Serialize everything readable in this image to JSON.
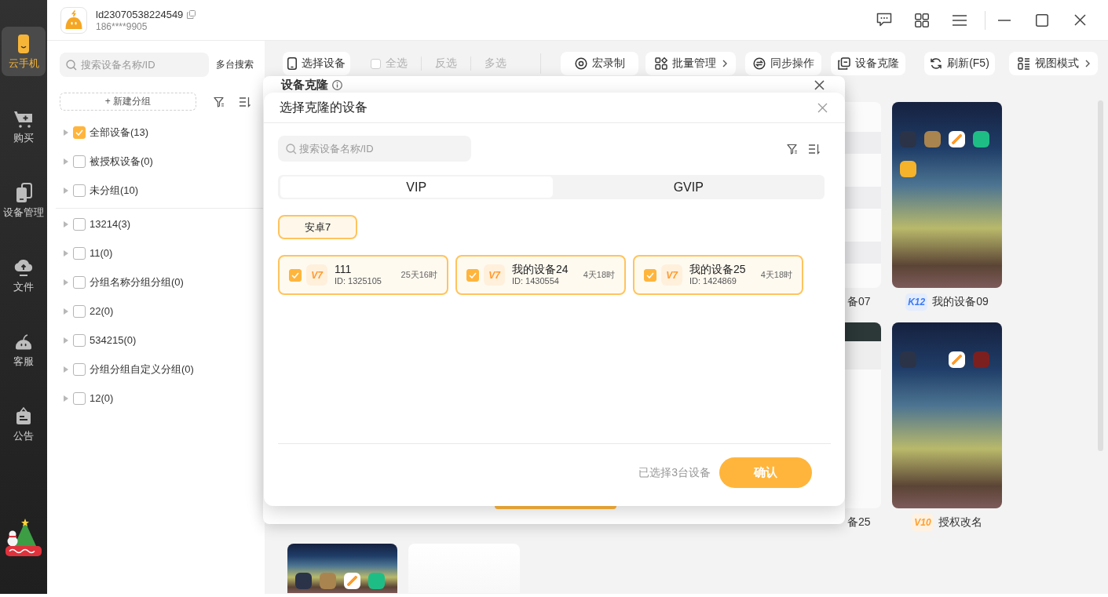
{
  "sidebar": {
    "items": [
      {
        "label": "云手机",
        "selected": true
      },
      {
        "label": "购买",
        "selected": false
      },
      {
        "label": "设备管理",
        "selected": false
      },
      {
        "label": "文件",
        "selected": false
      },
      {
        "label": "客服",
        "selected": false
      },
      {
        "label": "公告",
        "selected": false
      }
    ]
  },
  "header": {
    "account": "ld23070538224549",
    "phone": "186****9905"
  },
  "group_panel": {
    "search": {
      "placeholder": "搜索设备名称/ID"
    },
    "multi_search": "多台搜索",
    "new_group": "+ 新建分组",
    "sections": [
      {
        "groups": [
          {
            "label": "全部设备(13)",
            "checked": true,
            "expanded": false
          },
          {
            "label": "被授权设备(0)",
            "checked": false,
            "expanded": false
          },
          {
            "label": "未分组(10)",
            "checked": false,
            "expanded": false
          }
        ]
      },
      {
        "groups": [
          {
            "label": "13214(3)",
            "checked": false,
            "expanded": false
          },
          {
            "label": "11(0)",
            "checked": false,
            "expanded": false
          },
          {
            "label": "分组名称分组分组(0)",
            "checked": false,
            "expanded": false
          },
          {
            "label": "22(0)",
            "checked": false,
            "expanded": false
          },
          {
            "label": "534215(0)",
            "checked": false,
            "expanded": false
          },
          {
            "label": "分组分组自定义分组(0)",
            "checked": false,
            "expanded": false
          },
          {
            "label": "12(0)",
            "checked": false,
            "expanded": false
          }
        ]
      }
    ]
  },
  "toolbar": {
    "select_button": "选择设备",
    "selection": [
      {
        "kind": "check",
        "label": "全选",
        "checked": false,
        "disabled": true
      },
      {
        "kind": "text",
        "label": "反选",
        "disabled": true
      },
      {
        "kind": "text",
        "label": "多选",
        "disabled": true
      }
    ],
    "actions": [
      {
        "label": "宏录制",
        "chevron": false
      },
      {
        "label": "批量管理",
        "chevron": true
      },
      {
        "label": "同步操作",
        "chevron": false
      },
      {
        "label": "设备克隆",
        "chevron": false
      },
      {
        "label": "刷新(F5)",
        "chevron": false
      },
      {
        "label": "视图模式",
        "chevron": true
      }
    ]
  },
  "device_grid": {
    "cut_off_cards": [
      {
        "kind": "list",
        "label": "备07"
      },
      {
        "kind": "storage",
        "label": "备25"
      }
    ],
    "cards": [
      {
        "kind": "home",
        "badge": {
          "text": "K12",
          "color": "#3d7bf5"
        },
        "name": "我的设备09"
      },
      {
        "kind": "home",
        "badge": {
          "text": "V10",
          "color": "#ff9f2f"
        },
        "name": "授权改名"
      }
    ],
    "bottom_row": [
      {
        "kind": "home"
      },
      {
        "kind": "blank"
      }
    ]
  },
  "clone_dialog": {
    "title": "设备克隆"
  },
  "select_dialog": {
    "title": "选择克隆的设备",
    "search": {
      "placeholder": "搜索设备名称/ID"
    },
    "tabs": [
      {
        "label": "VIP",
        "selected": true
      },
      {
        "label": "GVIP",
        "selected": false
      }
    ],
    "versions": [
      {
        "label": "安卓7",
        "selected": true
      }
    ],
    "devices": [
      {
        "checked": true,
        "badge": "V7",
        "name": "111",
        "id": "ID: 1325105",
        "remaining": "25天16时"
      },
      {
        "checked": true,
        "badge": "V7",
        "name": "我的设备24",
        "id": "ID: 1430554",
        "remaining": "4天18时"
      },
      {
        "checked": true,
        "badge": "V7",
        "name": "我的设备25",
        "id": "ID: 1424869",
        "remaining": "4天18时"
      }
    ],
    "summary": "已选择3台设备",
    "confirm": "确认"
  }
}
